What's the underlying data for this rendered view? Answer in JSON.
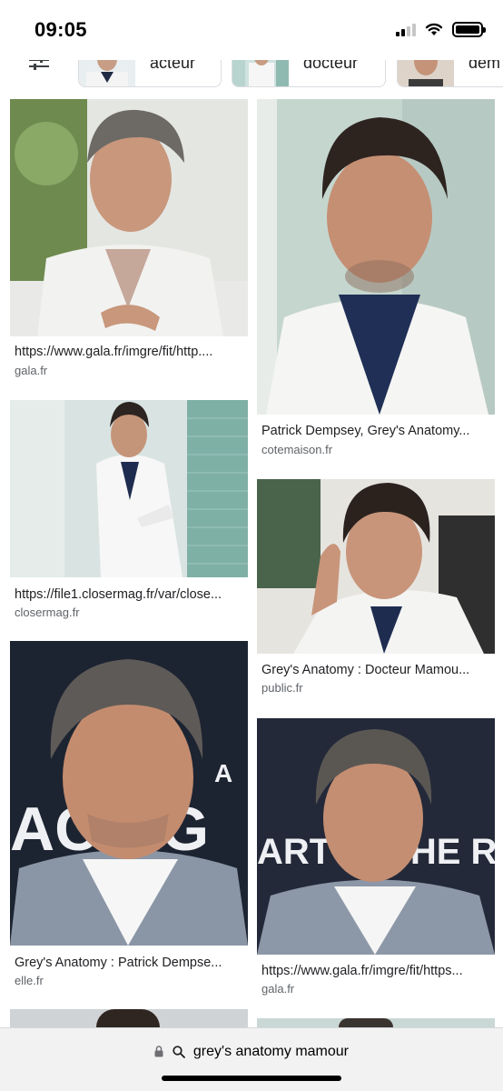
{
  "status": {
    "time": "09:05"
  },
  "chips": [
    {
      "label": "acteur"
    },
    {
      "label": "docteur"
    },
    {
      "label": "dem"
    }
  ],
  "results": [
    {
      "title": "https://www.gala.fr/imgre/fit/http....",
      "source": "gala.fr"
    },
    {
      "title": "Patrick Dempsey, Grey's Anatomy...",
      "source": "cotemaison.fr"
    },
    {
      "title": "https://file1.closermag.fr/var/close...",
      "source": "closermag.fr"
    },
    {
      "title": "Grey's Anatomy : Docteur Mamou...",
      "source": "public.fr"
    },
    {
      "title": "Grey's Anatomy : Patrick Dempse...",
      "source": "elle.fr"
    },
    {
      "title": "https://www.gala.fr/imgre/fit/https...",
      "source": "gala.fr"
    }
  ],
  "backdrop_text": {
    "left": "ACING",
    "left_small": "A",
    "right": "ART IN THE RAIN"
  },
  "address_bar": {
    "url": "grey's anatomy mamour"
  },
  "colors": {
    "link_source": "#5f6368",
    "text": "#202124",
    "bar_bg": "#f2f2f3"
  }
}
